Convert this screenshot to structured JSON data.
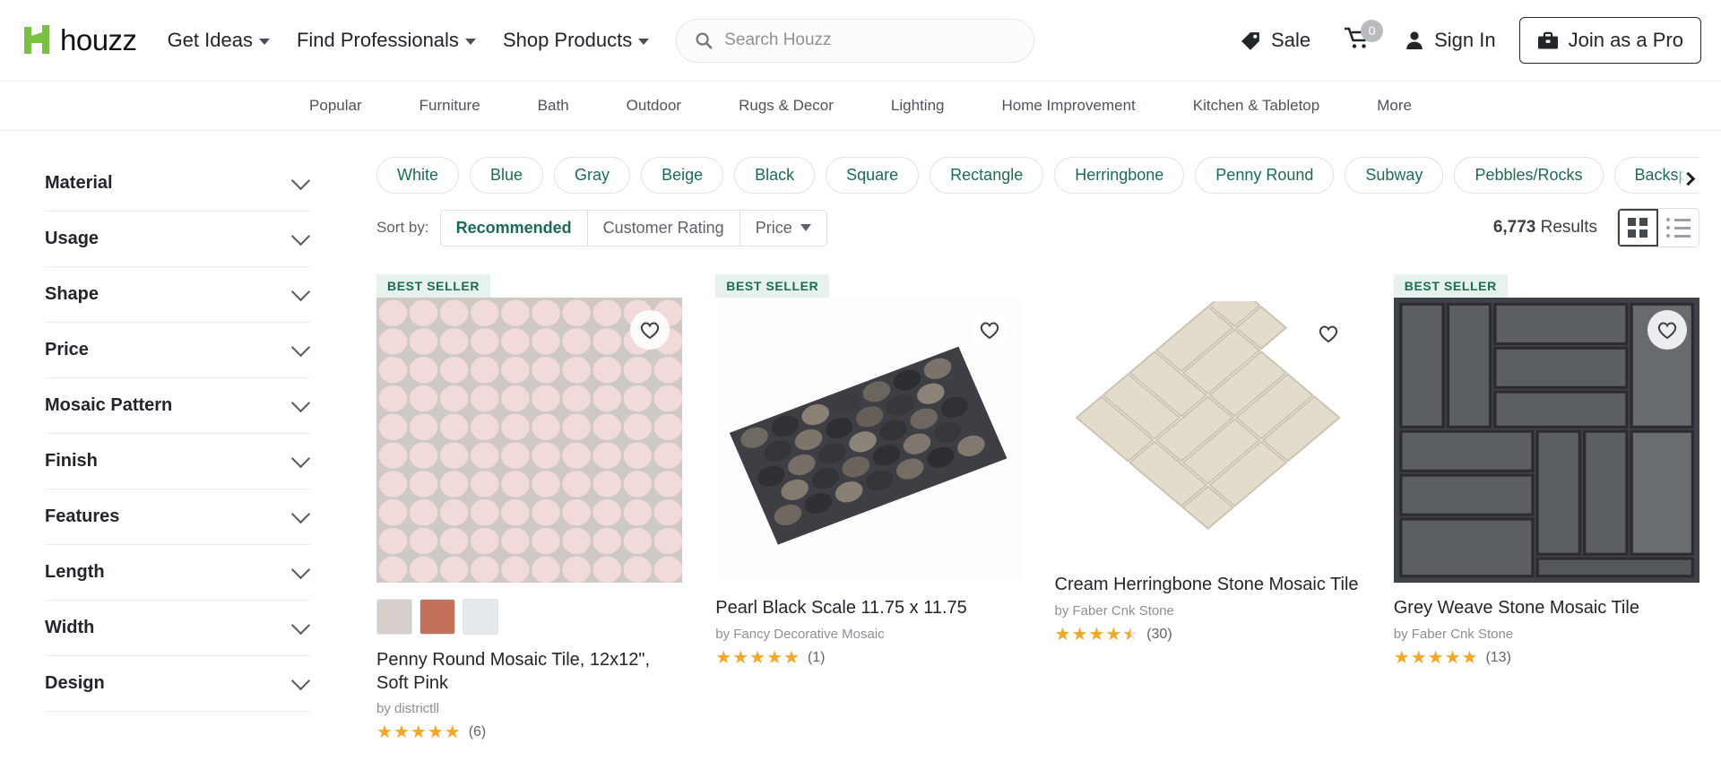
{
  "header": {
    "logo_text": "houzz",
    "logo_icon": "houzz-h-logo",
    "nav": [
      {
        "label": "Get Ideas",
        "icon": "chevron-down-icon"
      },
      {
        "label": "Find Professionals",
        "icon": "chevron-down-icon"
      },
      {
        "label": "Shop Products",
        "icon": "chevron-down-icon"
      }
    ],
    "search": {
      "placeholder": "Search Houzz",
      "value": "",
      "icon": "search-icon"
    },
    "sale": {
      "label": "Sale",
      "icon": "sale-tag-icon"
    },
    "cart": {
      "count": "0",
      "icon": "shopping-cart-icon"
    },
    "signin": {
      "label": "Sign In",
      "icon": "user-person-icon"
    },
    "join_pro": {
      "label": "Join as a Pro",
      "icon": "toolbox-icon"
    }
  },
  "subnav": {
    "items": [
      "Popular",
      "Furniture",
      "Bath",
      "Outdoor",
      "Rugs & Decor",
      "Lighting",
      "Home Improvement",
      "Kitchen & Tabletop",
      "More"
    ]
  },
  "sidebar": {
    "filters": [
      "Material",
      "Usage",
      "Shape",
      "Price",
      "Mosaic Pattern",
      "Finish",
      "Features",
      "Length",
      "Width",
      "Design"
    ]
  },
  "chips": {
    "items": [
      "White",
      "Blue",
      "Gray",
      "Beige",
      "Black",
      "Square",
      "Rectangle",
      "Herringbone",
      "Penny Round",
      "Subway",
      "Pebbles/Rocks",
      "Backsplash"
    ],
    "scroll_next_icon": "chevron-right-icon"
  },
  "sortbar": {
    "label": "Sort by:",
    "options": [
      {
        "label": "Recommended",
        "active": true
      },
      {
        "label": "Customer Rating",
        "active": false
      },
      {
        "label": "Price",
        "active": false,
        "icon": "caret-down-icon"
      }
    ],
    "results_count": "6,773",
    "results_suffix": " Results",
    "views": [
      {
        "name": "grid-view",
        "active": true
      },
      {
        "name": "list-view",
        "active": false
      }
    ]
  },
  "colors": {
    "brand_green": "#7ac143",
    "accent_green": "#1c6b55",
    "badge_bg": "#e7f2ee",
    "star": "#f5a623"
  },
  "products": [
    {
      "badge": "BEST SELLER",
      "title": "Penny Round Mosaic Tile, 12x12\", Soft Pink",
      "brand": "by districtll",
      "stars": 5,
      "review_count": "(6)",
      "swatches": [
        "#d6cfcb",
        "#c4715c",
        "#e6eaee"
      ],
      "image": "penny-round-pink-tile"
    },
    {
      "badge": "BEST SELLER",
      "title": "Pearl Black Scale 11.75 x 11.75",
      "brand": "by Fancy Decorative Mosaic",
      "stars": 5,
      "review_count": "(1)",
      "swatches": [],
      "image": "pearl-black-scale-tile"
    },
    {
      "badge": "",
      "title": "Cream Herringbone Stone Mosaic Tile",
      "brand": "by Faber Cnk Stone",
      "stars": 4.5,
      "review_count": "(30)",
      "swatches": [],
      "image": "cream-herringbone-tile"
    },
    {
      "badge": "BEST SELLER",
      "title": "Grey Weave Stone Mosaic Tile",
      "brand": "by Faber Cnk Stone",
      "stars": 5,
      "review_count": "(13)",
      "swatches": [],
      "image": "grey-weave-stone-tile"
    }
  ]
}
